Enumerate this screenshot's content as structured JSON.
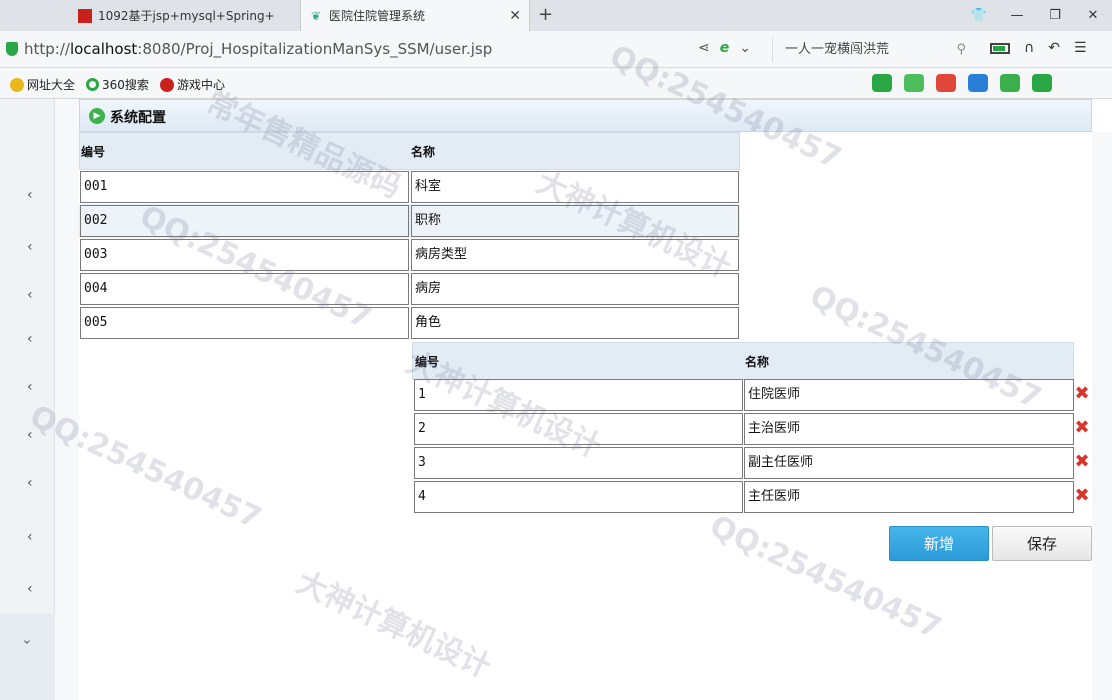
{
  "browser": {
    "tabs": [
      {
        "title": "1092基于jsp+mysql+Spring+",
        "active": false
      },
      {
        "title": "医院住院管理系统",
        "active": true
      }
    ],
    "url_prefix": "http://",
    "url_host": "localhost",
    "url_rest": ":8080/Proj_HospitalizationManSys_SSM/user.jsp",
    "search_text": "一人一宠横闯洪荒",
    "bookmarks": [
      "网址大全",
      "360搜索",
      "游戏中心"
    ]
  },
  "panel": {
    "title": "系统配置"
  },
  "left_grid": {
    "columns": [
      "编号",
      "名称"
    ],
    "rows": [
      {
        "id": "001",
        "name": "科室"
      },
      {
        "id": "002",
        "name": "职称"
      },
      {
        "id": "003",
        "name": "病房类型"
      },
      {
        "id": "004",
        "name": "病房"
      },
      {
        "id": "005",
        "name": "角色"
      }
    ],
    "selected_index": 1
  },
  "right_grid": {
    "columns": [
      "编号",
      "名称"
    ],
    "rows": [
      {
        "id": "1",
        "name": "住院医师"
      },
      {
        "id": "2",
        "name": "主治医师"
      },
      {
        "id": "3",
        "name": "副主任医师"
      },
      {
        "id": "4",
        "name": "主任医师"
      }
    ]
  },
  "buttons": {
    "add": "新增",
    "save": "保存"
  },
  "watermark": [
    "QQ:254540457",
    "常年售精品源码",
    "大神计算机设计"
  ]
}
